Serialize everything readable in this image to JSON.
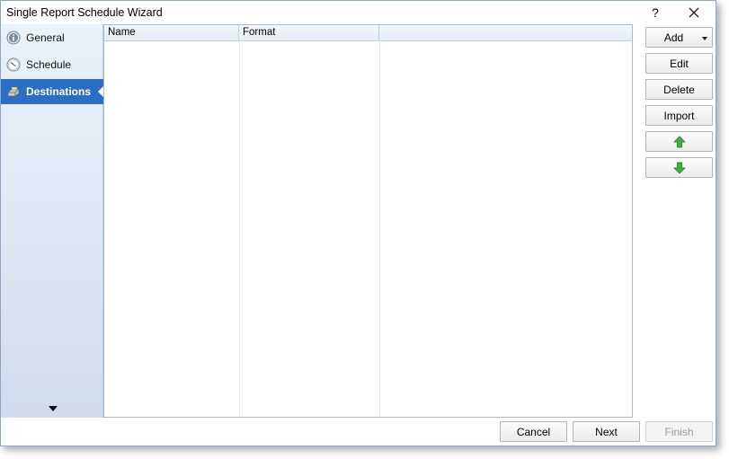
{
  "window": {
    "title": "Single Report Schedule Wizard",
    "help_label": "?",
    "close_icon": "close-icon"
  },
  "sidebar": {
    "items": [
      {
        "label": "General",
        "icon": "info-icon",
        "selected": false
      },
      {
        "label": "Schedule",
        "icon": "clock-icon",
        "selected": false
      },
      {
        "label": "Destinations",
        "icon": "printer-icon",
        "selected": true
      }
    ],
    "more_icon": "caret-down-icon"
  },
  "table": {
    "columns": [
      "Name",
      "Format",
      ""
    ],
    "rows": []
  },
  "actions": {
    "add_label": "Add",
    "edit_label": "Edit",
    "delete_label": "Delete",
    "import_label": "Import",
    "move_up_icon": "arrow-up-icon",
    "move_down_icon": "arrow-down-icon"
  },
  "footer": {
    "cancel_label": "Cancel",
    "next_label": "Next",
    "finish_label": "Finish"
  },
  "colors": {
    "selected_nav": "#2a6fc4",
    "arrow_green": "#3db33d"
  }
}
